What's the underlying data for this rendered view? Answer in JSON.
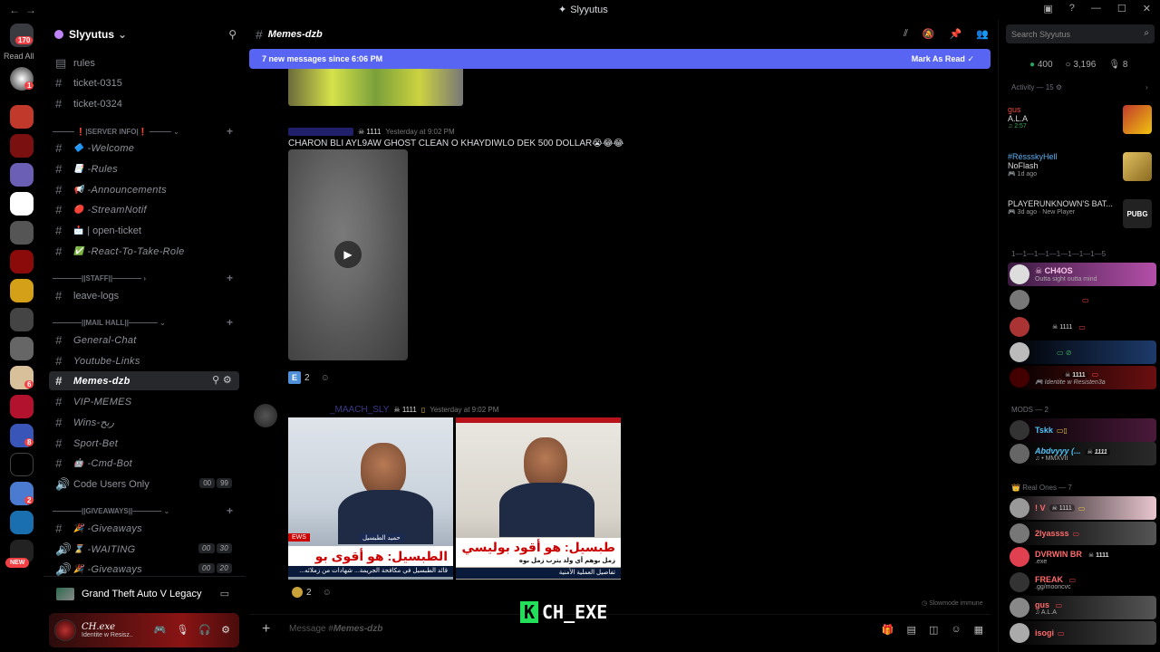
{
  "window": {
    "title": "Slyyutus"
  },
  "rail": {
    "home_badge": "170",
    "read_all": "Read All",
    "new_label": "NEW",
    "badges": [
      "1",
      "6",
      "2",
      "8"
    ]
  },
  "server": {
    "name": "Slyyutus"
  },
  "channels": [
    {
      "label": "rules"
    },
    {
      "label": "ticket-0315"
    },
    {
      "label": "ticket-0324"
    },
    {
      "label": "|SERVER INFO|"
    },
    {
      "label": "-Welcome"
    },
    {
      "label": "-Rules"
    },
    {
      "label": "-Announcements"
    },
    {
      "label": "-StreamNotif"
    },
    {
      "label": "| open-ticket"
    },
    {
      "label": "-React-To-Take-Role"
    },
    {
      "label": "STAFF"
    },
    {
      "label": "leave-logs"
    },
    {
      "label": "MAIL HALL"
    },
    {
      "label": "General-Chat"
    },
    {
      "label": "Youtube-Links"
    },
    {
      "label": "Memes-dzb"
    },
    {
      "label": "VIP-MEMES"
    },
    {
      "label": "Wins-ربح"
    },
    {
      "label": "Sport-Bet"
    },
    {
      "label": "-Cmd-Bot"
    },
    {
      "label": "Code Users Only",
      "tags": [
        "00",
        "99"
      ]
    },
    {
      "label": "GIVEAWAYS"
    },
    {
      "label": "-Giveaways"
    },
    {
      "label": "-WAITING",
      "tags": [
        "00",
        "30"
      ]
    },
    {
      "label": "-Giveaways",
      "tags": [
        "00",
        "20"
      ]
    }
  ],
  "voice": {
    "activity": "Grand Theft Auto V Legacy"
  },
  "user": {
    "name": "CH.exe",
    "status": "Identite w Resisz.."
  },
  "chat": {
    "channel": "Memes-dzb",
    "banner": "7 new messages since 6:06 PM",
    "mark_read": "Mark As Read",
    "msg1": {
      "badge": "1111",
      "time": "Yesterday at 9:02 PM",
      "text": "CHARON BLI AYL9AW GHOST CLEAN O KHAYDIWLO DEK 500 DOLLAR😭😂😂",
      "reaction_count": "2"
    },
    "msg2": {
      "author": "_MAACH_SLY",
      "badge": "1111",
      "time": "Yesterday at 9:02 PM",
      "reaction_count": "2",
      "img1": {
        "tag": "EWS",
        "name_tag": "حميد الطبسيل",
        "headline": "الطبسيل: هو أقوى بو",
        "ticker": "...قائد الطبسيل في مكافحة الجريمة... شهادات من زملائه"
      },
      "img2": {
        "headline": "طبسيل: هو أقود بوليسي",
        "sub": "زمل بوهم أي ولد يترب زمل بوه",
        "ticker": "تفاصيل العملية الأمنية"
      }
    },
    "composer_placeholder": "Message #",
    "composer_channel": "Memes-dzb",
    "slowmode": "Slowmode immune"
  },
  "watermark": {
    "k": "K",
    "text": "CH_EXE"
  },
  "members": {
    "search": "Search Slyyutus",
    "online": "400",
    "members": "3,196",
    "voice": "8",
    "activity_header": "Activity — 15",
    "activities": [
      {
        "name": "gus",
        "title": "A.L.A",
        "sub": "2:57",
        "color": "#e74c3c"
      },
      {
        "name": "#RéssskyHell",
        "title": "NoFlash",
        "sub": "1d ago",
        "color": "#5ab0f2"
      },
      {
        "name": "",
        "title": "PLAYERUNKNOWN'S BAT...",
        "sub": "3d ago · New Player",
        "color": "#ddd"
      }
    ],
    "group1_header": "1—1—1—1—1—1—1—1—5",
    "group1": [
      {
        "name": "CH4OS",
        "sub": "Outta sight outta mind"
      },
      {
        "name": "",
        "sub": ""
      },
      {
        "name": "1111",
        "sub": ""
      },
      {
        "name": "",
        "sub": ""
      },
      {
        "name": "1111",
        "sub": "Identite w Resisten3a"
      }
    ],
    "mods_header": "MODS — 2",
    "mods": [
      {
        "name": "Tskk",
        "sub": ""
      },
      {
        "name": "Abdvyyy (...",
        "badge": "1111",
        "sub": "MMXVII"
      }
    ],
    "real_header": "Real Ones — 7",
    "real": [
      {
        "name": "! V",
        "badge": "1111"
      },
      {
        "name": "2lyassss"
      },
      {
        "name": "DVRWIN BR",
        "badge": "1111",
        "sub": ".exe"
      },
      {
        "name": "FREAK",
        "sub": ".gg/mooncvc"
      },
      {
        "name": "gus",
        "sub": "A.L.A"
      },
      {
        "name": "isogi"
      }
    ]
  }
}
